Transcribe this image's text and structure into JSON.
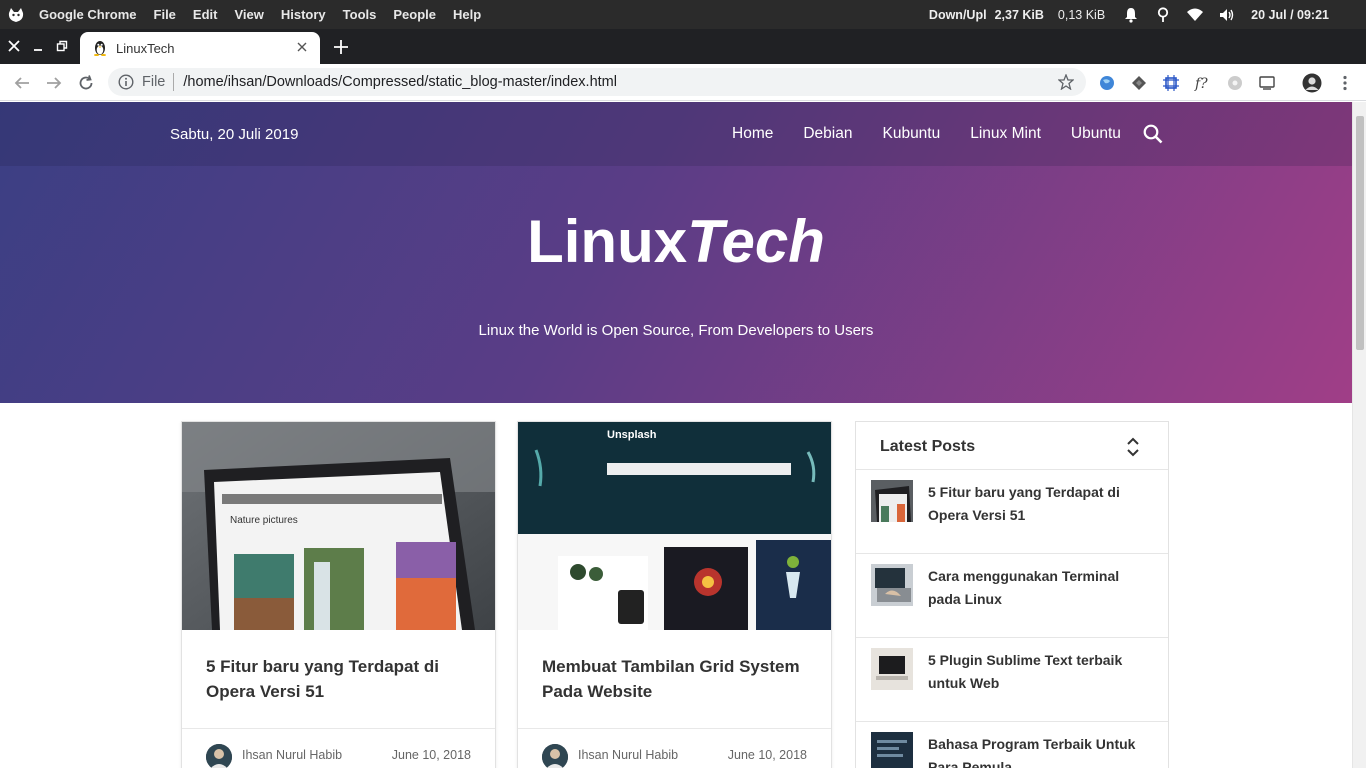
{
  "os_bar": {
    "menu": [
      "Google Chrome",
      "File",
      "Edit",
      "View",
      "History",
      "Tools",
      "People",
      "Help"
    ],
    "net_label": "Down/Upl",
    "net_down": "2,37 KiB",
    "net_up": "0,13 KiB",
    "clock": "20 Jul / 09:21"
  },
  "browser": {
    "tab_title": "LinuxTech",
    "url_scheme": "File",
    "url": "/home/ihsan/Downloads/Compressed/static_blog-master/index.html"
  },
  "site": {
    "date": "Sabtu, 20 Juli 2019",
    "nav": [
      "Home",
      "Debian",
      "Kubuntu",
      "Linux Mint",
      "Ubuntu"
    ],
    "brand_main": "Linux",
    "brand_italic": "Tech",
    "tagline": "Linux the World is Open Source, From Developers to Users"
  },
  "cards": [
    {
      "title": "5 Fitur baru yang Terdapat di Opera Versi 51",
      "author": "Ihsan Nurul Habib",
      "date": "June 10, 2018",
      "image_overlay": "Nature pictures"
    },
    {
      "title": "Membuat Tambilan Grid System Pada Website",
      "author": "Ihsan Nurul Habib",
      "date": "June 10, 2018",
      "image_overlay": "Unsplash"
    }
  ],
  "sidebar": {
    "title": "Latest Posts",
    "items": [
      "5 Fitur baru yang Terdapat di Opera Versi 51",
      "Cara menggunakan Terminal pada Linux",
      "5 Plugin Sublime Text terbaik untuk Web",
      "Bahasa Program Terbaik Untuk Para Pemula"
    ]
  },
  "colors": {
    "hero_start": "#3b3f84",
    "hero_end": "#a03e87",
    "os_bar": "#2b2b2b",
    "tab_strip": "#202124"
  }
}
